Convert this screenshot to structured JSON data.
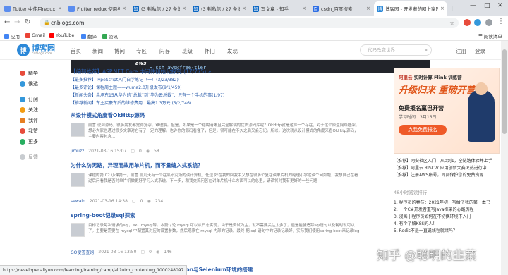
{
  "browser": {
    "tabs": [
      {
        "title": "flutter 中使用redux之基",
        "color": "#5b8def"
      },
      {
        "title": "Flutter redux 使用与线",
        "color": "#5b8def"
      },
      {
        "title": "(3 封私信 / 27 条消息",
        "color": "#0a66c2"
      },
      {
        "title": "(3 封私信 / 27 条消息",
        "color": "#0a66c2"
      },
      {
        "title": "写文章 - 知乎",
        "color": "#0a66c2"
      },
      {
        "title": "csdn_百度搜索",
        "color": "#2f6fe4"
      },
      {
        "title": "博客园 - 开发者的网上家园",
        "color": "#2b88d8"
      }
    ],
    "url": "cnblogs.com",
    "bookmarks": [
      "应用",
      "Gmail",
      "YouTube",
      "翻译",
      "资讯"
    ],
    "reading_list": "阅读清单"
  },
  "site": {
    "logo": "博客园",
    "logo_sub": "cnblogs.com",
    "nav": [
      "首页",
      "新闻",
      "博问",
      "专区",
      "闪存",
      "班级",
      "怀旧",
      "发现"
    ],
    "search_placeholder": "代码改变世界",
    "login": "注册",
    "register": "登录",
    "banner_brand": "aws",
    "banner_cmd": "~ ssh aws@free-tier"
  },
  "sidebar": {
    "items": [
      {
        "label": "精华",
        "color": "#e74c3c"
      },
      {
        "label": "候选",
        "color": "#3498db"
      },
      {
        "label": "订阅",
        "color": "#3498db"
      },
      {
        "label": "关注",
        "color": "#f39c12"
      },
      {
        "label": "我评",
        "color": "#e67e22"
      },
      {
        "label": "我赞",
        "color": "#e74c3c"
      },
      {
        "label": "更多",
        "color": "#27ae60"
      },
      {
        "label": "反馈",
        "color": "#95a5a6"
      }
    ]
  },
  "pinned": [
    "【编辑推荐】ASP.NET Core 中间件初始化探究 (17/775) »",
    "【最多推荐】TypeScript入门自学笔记（一）(3/23/382)",
    "【最多评论】课程周主题——wuma2.0升级发布(9/1/459)",
    "【新闻头条】余承东15从华为的“总裁”到“华为云总裁”：只有一个手机的事(1/97)",
    "【推荐新闻】车主买豪车后的维修费用：最高1.3万元 (5/2/746)"
  ],
  "posts": [
    {
      "title": "从设计模式角度看OkHttp源码",
      "summary": "前言 说到源码，很多朋友都觉得复杂，难理解。但是，如果是一个结构清晰且完全解耦的优质源码库呢？OkHttp就是这样一个存在，对于这个原生网络框架，想必大家也通过很多文章对它有了一定的理解。也许你的源码看懂了，但是，很可能在不久之后又会忘记。所以，这次就从设计模式的角度来看OkHttp源码，主要内容包含... ",
      "author": "jimuzz",
      "time": "2021-03-16 15:07",
      "comments": "0",
      "views": "58"
    },
    {
      "title": "为什么防无路，异理而故用单片机，而不量编入式系统？",
      "summary": "课程的第 02 小课第一，前言 前几天有一个在某研究所的读计算机、任位 好在我的回我中又想在很多个复在读单片机的经理小学这读个问如题，我想自己在看过后问看我是否对单片机做更好学习入式系统。下一步，和我交流问答在讲单片机什么方面可以的总里，请读将对我有更好的一些问题 ",
      "author": "sewain",
      "time": "2021-03-16 14:38",
      "comments": "0",
      "views": "234"
    },
    {
      "title": "spring-boot记录sql探索",
      "summary": "目标记录每次请求的sql，ex。mysql等。本篇讨论 mysql 可以从日志实现，由于是调试为主，就不需要关注太多了，但是能够追踪sql语句以及耗时就可以了。主要是需要在 mysql 中配置其对应的设置参数，然后观察在 mysql 内部的记录。最终 把 sql 语句中的记录记录好，实际我们使用spring-boot来记录log ",
      "author": "GO便签查询",
      "time": "2021-03-16 13:50",
      "comments": "0",
      "views": "146"
    }
  ],
  "bottom_title": "之 Python与Selenium环境的搭建",
  "right": {
    "ad_line1_red": "阿里云",
    "ad_line1": "实时计算 Flink 训练营",
    "ad_big": "升级归来 重磅开营",
    "ad_line2": "免费报名赢巴开营",
    "ad_line3": "学习时间：3月16日",
    "ad_button": "点我免费报名",
    "links": [
      "【推荐】网安社区入门：从0到1，全链路体验并上手",
      "【推荐】阿里云 RISC-V 应用创新大赛火热进行中",
      "【推荐】注册AWS账号，即刻保护您的免费资源"
    ],
    "hot_heading": "48小时阅读排行",
    "hot": [
      "1. 程序员的春节：2021年初，写给了我的第一本书",
      "2. 一个C#开发者重写Java框架的心路历程",
      "3. 漫画 | 程序员如何在不切换环境下入门",
      "4. 有个了解K8S的人！",
      "5. Redis不是一直说线程就绪吗？"
    ]
  },
  "watermark": "知乎 @聪明的韭菜",
  "status_url": "https://developer.aliyun.com/learning/training/camp/ali?utm_content=g_1000248097"
}
